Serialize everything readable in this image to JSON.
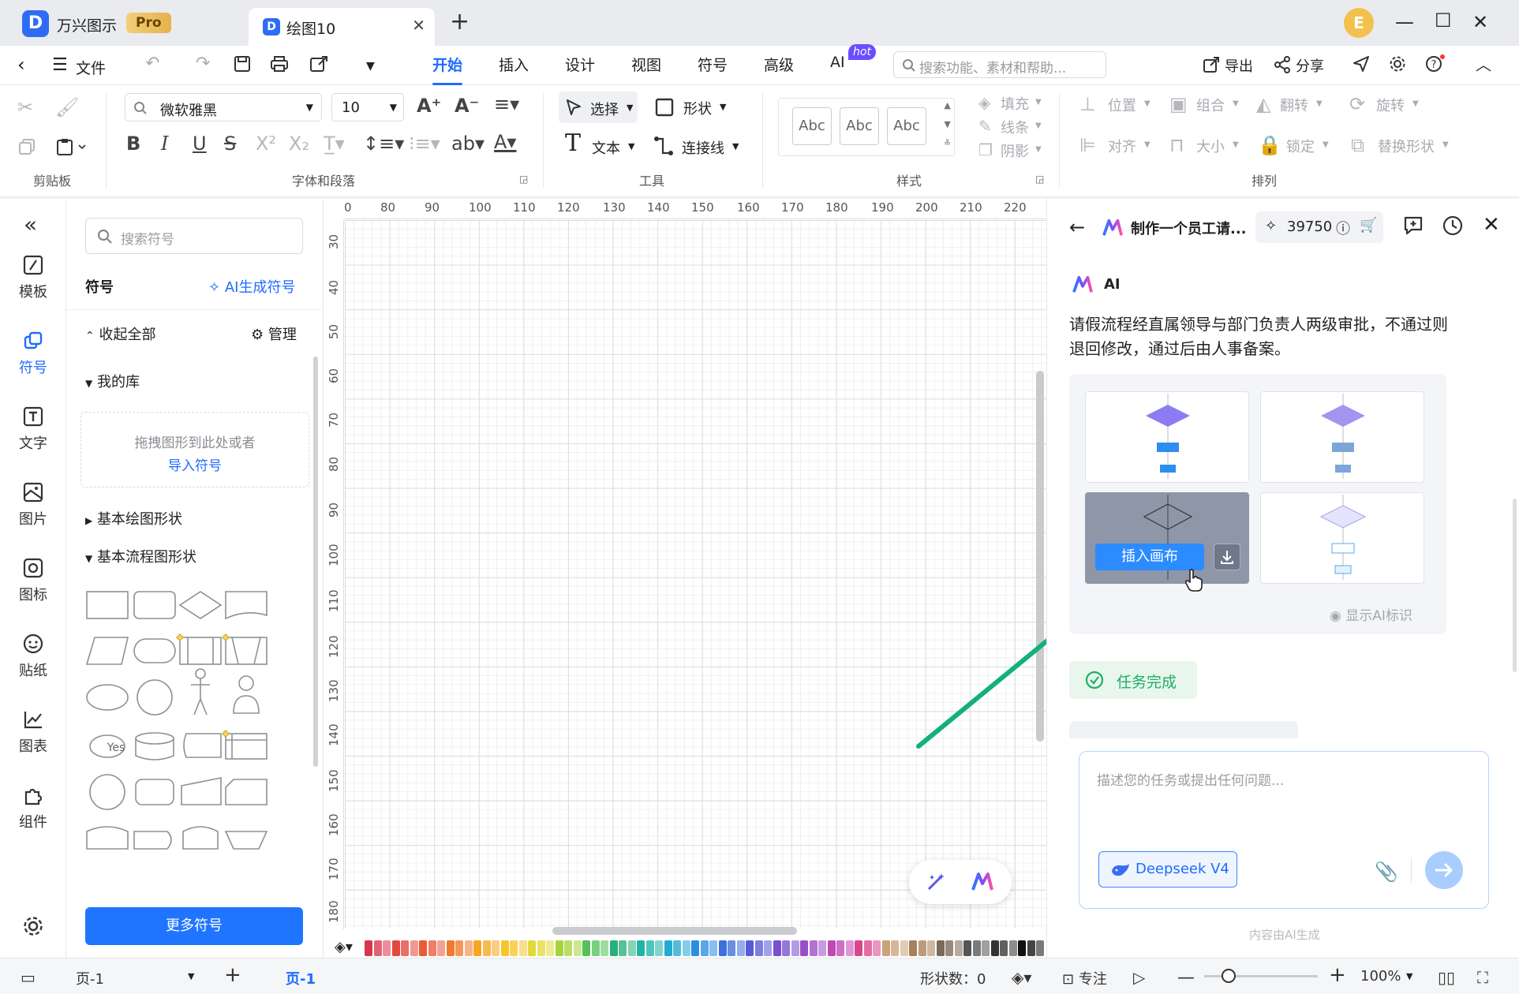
{
  "titlebar": {
    "app_name": "万兴图示",
    "badge": "Pro",
    "tab_title": "绘图10",
    "avatar_letter": "E"
  },
  "menubar": {
    "file": "文件",
    "tabs": [
      "开始",
      "插入",
      "设计",
      "视图",
      "符号",
      "高级",
      "AI"
    ],
    "active_tab": "开始",
    "hot_badge": "hot",
    "search_placeholder": "搜索功能、素材和帮助...",
    "export": "导出",
    "share": "分享"
  },
  "ribbon": {
    "clipboard_label": "剪贴板",
    "font_name": "微软雅黑",
    "font_size": "10",
    "font_label": "字体和段落",
    "select": "选择",
    "shape": "形状",
    "text": "文本",
    "connector": "连接线",
    "tools_label": "工具",
    "style_swatch": "Abc",
    "fill": "填充",
    "line": "线条",
    "shadow": "阴影",
    "style_label": "样式",
    "position": "位置",
    "group": "组合",
    "flip": "翻转",
    "rotate": "旋转",
    "align": "对齐",
    "size": "大小",
    "lock": "锁定",
    "replace": "替换形状",
    "arrange_label": "排列"
  },
  "leftnav": {
    "items": [
      "模板",
      "符号",
      "文字",
      "图片",
      "图标",
      "贴纸",
      "图表",
      "组件"
    ],
    "active": "符号"
  },
  "sympanel": {
    "search_placeholder": "搜索符号",
    "heading": "符号",
    "ai_link": "AI生成符号",
    "collapse_all": "收起全部",
    "manage": "管理",
    "my_library": "我的库",
    "drop_hint": "拖拽图形到此处或者",
    "import_link": "导入符号",
    "basic_shapes": "基本绘图形状",
    "basic_flow": "基本流程图形状",
    "yes_label": "Yes",
    "more_button": "更多符号"
  },
  "canvas": {
    "ruler_h": [
      "0",
      "80",
      "90",
      "100",
      "110",
      "120",
      "130",
      "140",
      "150",
      "160",
      "170",
      "180",
      "190",
      "200",
      "210",
      "220"
    ],
    "ruler_v": [
      "30",
      "40",
      "50",
      "60",
      "70",
      "80",
      "90",
      "100",
      "110",
      "120",
      "130",
      "140",
      "150",
      "160",
      "170",
      "180"
    ],
    "palette": [
      "#d9364e",
      "#e4473d",
      "#ea5a3a",
      "#f07a2d",
      "#f6a623",
      "#f7c52a",
      "#e4d93b",
      "#a8d33d",
      "#54c15a",
      "#27b07d",
      "#1fb3a8",
      "#22a9d4",
      "#2d8de0",
      "#3e6fdc",
      "#5a5ad8",
      "#7a4fd0",
      "#9a4cc8",
      "#c049b3",
      "#d8468c",
      "#c9a37a",
      "#a9805a",
      "#7b6a5a",
      "#555555",
      "#333333",
      "#111111"
    ],
    "accent_arrow": "#13b07e"
  },
  "aipanel": {
    "title": "制作一个员工请...",
    "credits": "39750",
    "ai_label": "AI",
    "message": "请假流程经直属领导与部门负责人两级审批，不通过则退回修改，通过后由人事备案。",
    "insert_button": "插入画布",
    "show_ai_mark": "显示AI标识",
    "task_done": "任务完成",
    "input_placeholder": "描述您的任务或提出任何问题...",
    "model": "Deepseek V4",
    "ai_generated_note": "内容由AI生成"
  },
  "statusbar": {
    "page_select": "页-1",
    "page_tab": "页-1",
    "shape_count": "形状数：0",
    "focus": "专注",
    "zoom": "100%"
  }
}
